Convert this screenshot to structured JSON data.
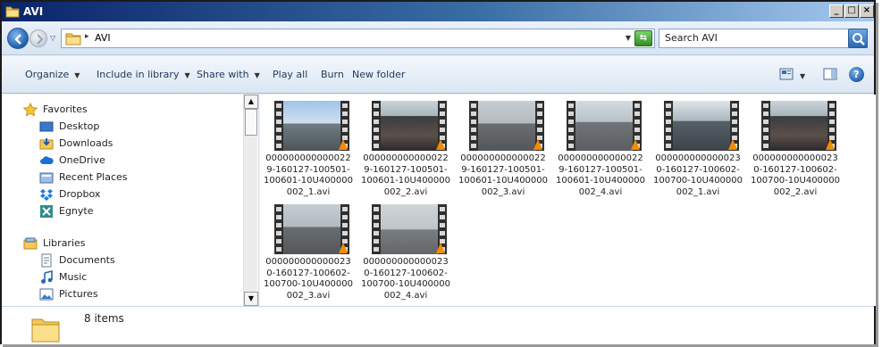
{
  "window": {
    "title": "AVI"
  },
  "address": {
    "path": "AVI",
    "search_placeholder": "Search AVI"
  },
  "toolbar": {
    "organize": "Organize",
    "include_in_library": "Include in library",
    "share_with": "Share with",
    "play_all": "Play all",
    "burn": "Burn",
    "new_folder": "New folder"
  },
  "nav": {
    "favorites": {
      "label": "Favorites",
      "items": [
        "Desktop",
        "Downloads",
        "OneDrive",
        "Recent Places",
        "Dropbox",
        "Egnyte"
      ]
    },
    "libraries": {
      "label": "Libraries",
      "items": [
        "Documents",
        "Music",
        "Pictures"
      ]
    }
  },
  "files": [
    {
      "lines": [
        "000000000000022",
        "9-160127-100501-",
        "100601-10U400000",
        "002_1.avi"
      ],
      "scene": "highway"
    },
    {
      "lines": [
        "000000000000022",
        "9-160127-100501-",
        "100601-10U400000",
        "002_2.avi"
      ],
      "scene": "cabin"
    },
    {
      "lines": [
        "000000000000022",
        "9-160127-100501-",
        "100601-10U400000",
        "002_3.avi"
      ],
      "scene": "road"
    },
    {
      "lines": [
        "000000000000022",
        "9-160127-100501-",
        "100601-10U400000",
        "002_4.avi"
      ],
      "scene": "road2"
    },
    {
      "lines": [
        "000000000000023",
        "0-160127-100602-",
        "100700-10U400000",
        "002_1.avi"
      ],
      "scene": "traffic"
    },
    {
      "lines": [
        "000000000000023",
        "0-160127-100602-",
        "100700-10U400000",
        "002_2.avi"
      ],
      "scene": "cabin"
    },
    {
      "lines": [
        "000000000000023",
        "0-160127-100602-",
        "100700-10U400000",
        "002_3.avi"
      ],
      "scene": "road"
    },
    {
      "lines": [
        "000000000000023",
        "0-160127-100602-",
        "100700-10U400000",
        "002_4.avi"
      ],
      "scene": "rain"
    }
  ],
  "status": {
    "item_count": "8 items"
  },
  "colors": {
    "title_start": "#0a246a",
    "title_end": "#a6caf0",
    "command_text": "#1e395b"
  }
}
